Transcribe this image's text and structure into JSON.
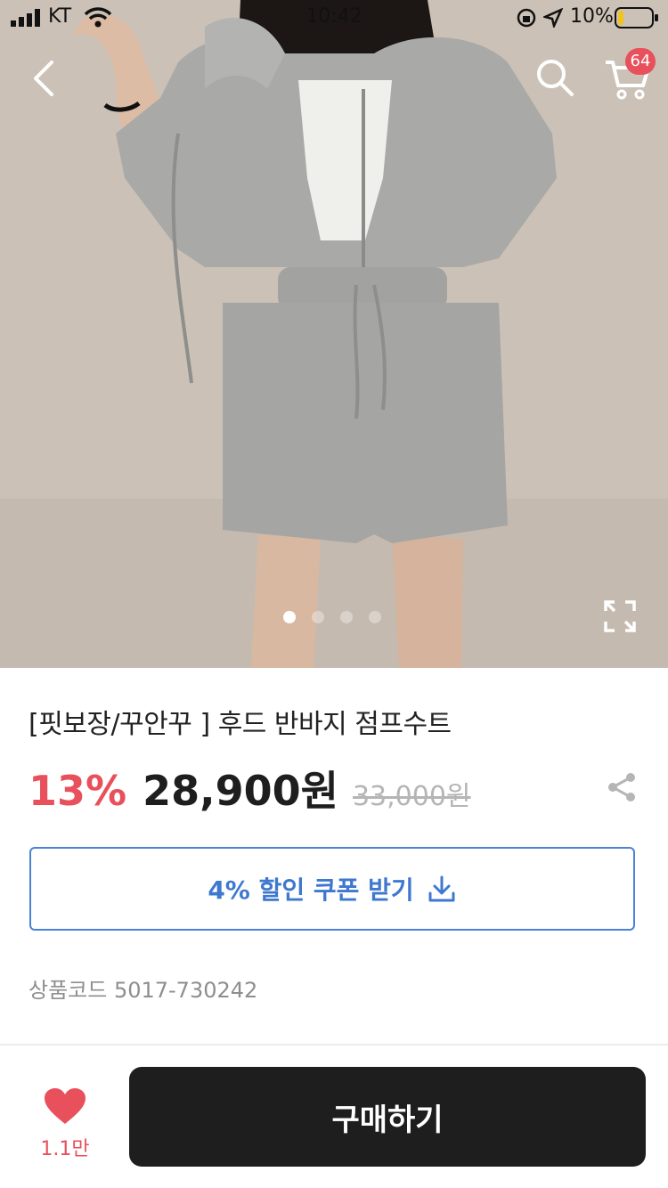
{
  "status_bar": {
    "carrier": "KT",
    "time": "10:42",
    "battery_percent": "10%"
  },
  "nav": {
    "back_icon": "chevron-left-icon",
    "search_icon": "search-icon",
    "cart_icon": "cart-icon",
    "cart_count": "64"
  },
  "gallery": {
    "image_count": 4,
    "active_index": 0,
    "expand_icon": "expand-icon"
  },
  "product": {
    "title": "[핏보장/꾸안꾸 ] 후드 반바지 점프수트",
    "discount": "13%",
    "price": "28,900원",
    "original_price": "33,000원",
    "share_icon": "share-icon",
    "coupon_label": "4% 할인 쿠폰 받기",
    "coupon_icon": "download-icon",
    "product_code": "상품코드 5017-730242"
  },
  "bottom_bar": {
    "like_icon": "heart-icon",
    "like_count": "1.1만",
    "buy_label": "구매하기"
  },
  "colors": {
    "accent_red": "#e8505b",
    "coupon_blue": "#3f78cf",
    "buy_button": "#1e1e1e"
  }
}
